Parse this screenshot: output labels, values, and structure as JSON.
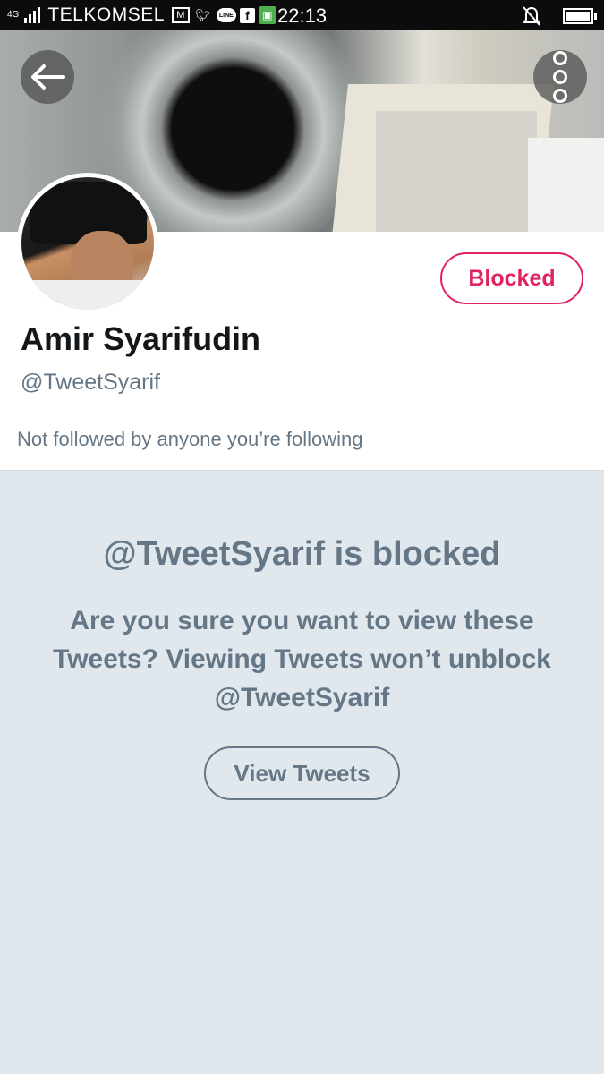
{
  "status_bar": {
    "network": "4G",
    "carrier": "TELKOMSEL",
    "notification_icons": [
      "gmail-icon",
      "twitter-icon",
      "line-icon",
      "facebook-icon",
      "android-icon"
    ],
    "time": "22:13",
    "right_icons": [
      "alarm-off-icon",
      "battery-icon"
    ]
  },
  "header": {
    "back_icon": "back-arrow-icon",
    "more_icon": "more-options-icon"
  },
  "profile": {
    "name": "Amir Syarifudin",
    "handle": "@TweetSyarif",
    "follow_note": "Not followed by anyone you’re following",
    "blocked_button": "Blocked"
  },
  "blocked_notice": {
    "title": "@TweetSyarif is blocked",
    "body": "Are you sure you want to view these Tweets? Viewing Tweets won’t unblock @TweetSyarif",
    "view_button": "View Tweets"
  },
  "colors": {
    "accent_blocked": "#e0245e",
    "muted_text": "#657786",
    "panel_bg": "#e1e8ed"
  }
}
